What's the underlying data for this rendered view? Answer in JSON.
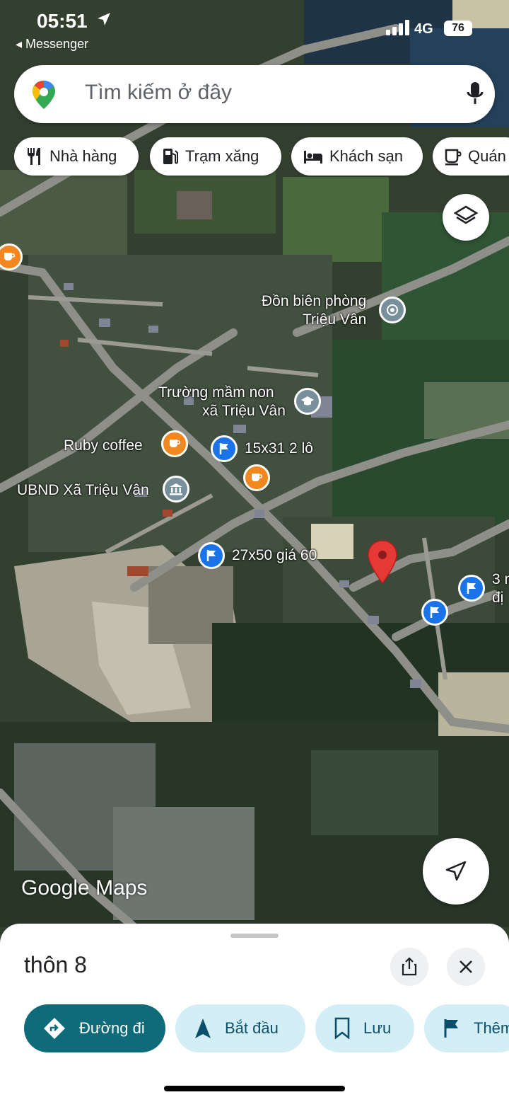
{
  "status_bar": {
    "time": "05:51",
    "back_app": "◂ Messenger",
    "network": "4G",
    "battery": "76"
  },
  "search": {
    "placeholder": "Tìm kiếm ở đây"
  },
  "chips": [
    {
      "label": "Nhà hàng",
      "icon": "fork-knife-icon"
    },
    {
      "label": "Trạm xăng",
      "icon": "gas-pump-icon"
    },
    {
      "label": "Khách sạn",
      "icon": "bed-icon"
    },
    {
      "label": "Quán",
      "icon": "coffee-cup-icon"
    }
  ],
  "map_labels": {
    "border_post_line1": "Đồn biên phòng",
    "border_post_line2": "Triệu Vân",
    "school_line1": "Trường mầm non",
    "school_line2": "xã Triệu Vân",
    "ruby_coffee": "Ruby coffee",
    "lot_15x31": "15x31 2 lô",
    "ubnd": "UBND Xã Triệu Vân",
    "lot_27x50": "27x50 giá 60",
    "edge_label_line1": "3 n",
    "edge_label_line2": "đị"
  },
  "watermark": "Google Maps",
  "bottom_sheet": {
    "title": "thôn 8",
    "actions": [
      {
        "label": "Đường đi"
      },
      {
        "label": "Bắt đầu"
      },
      {
        "label": "Lưu"
      },
      {
        "label": "Thêm"
      }
    ]
  },
  "colors": {
    "poi_orange": "#f2861f",
    "poi_blue": "#1a73e8",
    "poi_gray": "#78909c",
    "pin_red": "#e53935",
    "primary_action": "#0f6b79",
    "secondary_action": "#d3eef5"
  }
}
